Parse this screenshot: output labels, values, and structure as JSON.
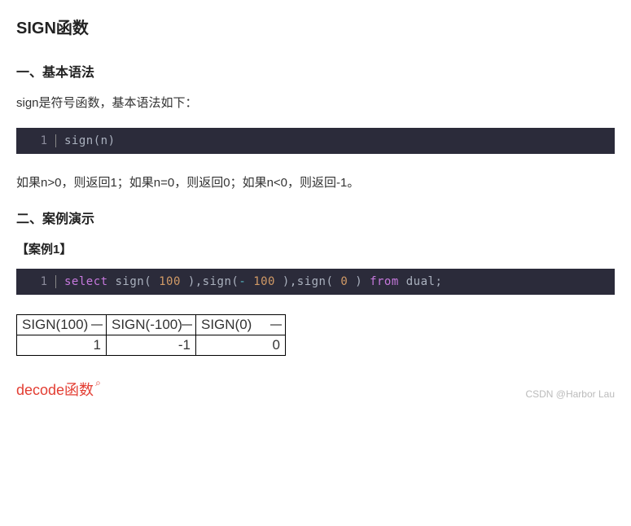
{
  "title": "SIGN函数",
  "section1": {
    "heading": "一、基本语法",
    "intro": "sign是符号函数，基本语法如下：",
    "code_lineno": "1",
    "code": "sign(n)",
    "explain": "如果n>0，则返回1；如果n=0，则返回0；如果n<0，则返回-1。"
  },
  "section2": {
    "heading": "二、案例演示",
    "example_label": "【案例1】",
    "code_lineno": "1",
    "code_tokens": {
      "select": "select",
      "sign1_open": " sign( ",
      "n100": "100",
      "close1": " ),sign(",
      "minus": "- ",
      "n100b": "100",
      "close2": " ),sign( ",
      "n0": "0",
      "close3": " ) ",
      "from": "from",
      "space": " ",
      "dual": "dual",
      "semi": ";"
    },
    "result": {
      "headers": [
        "SIGN(100)",
        "SIGN(-100)",
        "SIGN(0)"
      ],
      "row": [
        "1",
        "-1",
        "0"
      ]
    }
  },
  "link_text": "decode函数",
  "watermark": "CSDN @Harbor Lau",
  "chart_data": {
    "type": "table",
    "title": "SIGN function results",
    "headers": [
      "SIGN(100)",
      "SIGN(-100)",
      "SIGN(0)"
    ],
    "rows": [
      [
        1,
        -1,
        0
      ]
    ]
  }
}
